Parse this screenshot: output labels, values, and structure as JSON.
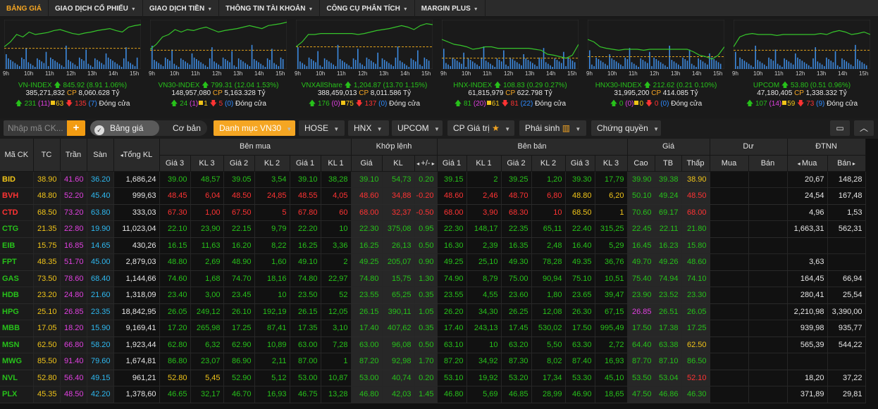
{
  "nav": {
    "items": [
      {
        "label": "BẢNG GIÁ",
        "active": true,
        "has_caret": false
      },
      {
        "label": "GIAO DỊCH CỔ PHIẾU",
        "has_caret": true
      },
      {
        "label": "GIAO DỊCH TIỀN",
        "has_caret": true
      },
      {
        "label": "THÔNG TIN TÀI KHOẢN",
        "has_caret": true
      },
      {
        "label": "CÔNG CỤ PHÂN TÍCH",
        "has_caret": true
      },
      {
        "label": "MARGIN PLUS",
        "has_caret": true
      }
    ]
  },
  "colors": {
    "up": "#27c11a",
    "down": "#ff3333",
    "ref": "#f0c419",
    "ceiling": "#e040e0",
    "floor": "#2eb8f0",
    "accent": "#f5a623",
    "chart_line": "#36c52b",
    "chart_bar": "#3d8ae0",
    "ref_line": "#e0a01a"
  },
  "indices": [
    {
      "name": "VN-INDEX",
      "value": "845.92",
      "change": "(8.91 1.06%)",
      "volume": "385,271,832",
      "cp": "CP",
      "value_text": "8,060.628 Tỷ",
      "up": "231",
      "up_ceil": "(11)",
      "ref": "63",
      "down": "135",
      "down_floor": "(7)",
      "status": "Đóng cửa",
      "dir": "up",
      "shape": [
        0.55,
        0.45,
        0.3,
        0.35,
        0.25,
        0.3,
        0.28,
        0.26,
        0.22,
        0.2,
        0.24,
        0.28,
        0.3,
        0.27,
        0.25,
        0.22,
        0.2,
        0.18,
        0.22,
        0.25,
        0.15,
        0.12,
        0.1
      ],
      "ref_level": 0.58
    },
    {
      "name": "VN30-INDEX",
      "value": "799.31",
      "change": "(12.04 1.53%)",
      "volume": "148,957,080",
      "cp": "CP",
      "value_text": "5,163.328 Tỷ",
      "up": "24",
      "up_ceil": "(1)",
      "ref": "1",
      "down": "5",
      "down_floor": "(0)",
      "status": "Đóng cửa",
      "dir": "up",
      "shape": [
        0.6,
        0.5,
        0.35,
        0.3,
        0.2,
        0.25,
        0.2,
        0.22,
        0.18,
        0.15,
        0.2,
        0.25,
        0.22,
        0.2,
        0.18,
        0.15,
        0.12,
        0.15,
        0.18,
        0.12,
        0.1,
        0.08,
        0.05
      ],
      "ref_level": 0.62
    },
    {
      "name": "VNXAllShare",
      "value": "1,204.87",
      "change": "(13.70 1.15%)",
      "volume": "388,459,013",
      "cp": "CP",
      "value_text": "8,011.586 Tỷ",
      "up": "176",
      "up_ceil": "(0)",
      "ref": "75",
      "down": "137",
      "down_floor": "(0)",
      "status": "Đóng cửa",
      "dir": "up",
      "shape": [
        0.55,
        0.45,
        0.3,
        0.3,
        0.28,
        0.28,
        0.28,
        0.28,
        0.28,
        0.28,
        0.3,
        0.28,
        0.25,
        0.22,
        0.2,
        0.18,
        0.15,
        0.12,
        0.15,
        0.2,
        0.12,
        0.08,
        0.1
      ],
      "ref_level": 0.55
    },
    {
      "name": "HNX-INDEX",
      "value": "108.83",
      "change": "(0.29 0.27%)",
      "volume": "61,815,979",
      "cp": "CP",
      "value_text": "622.798 Tỷ",
      "up": "81",
      "up_ceil": "(20)",
      "ref": "61",
      "down": "81",
      "down_floor": "(22)",
      "status": "Đóng cửa",
      "dir": "up",
      "shape": [
        0.4,
        0.45,
        0.5,
        0.52,
        0.55,
        0.6,
        0.58,
        0.55,
        0.55,
        0.58,
        0.58,
        0.58,
        0.58,
        0.58,
        0.58,
        0.6,
        0.62,
        0.7,
        0.72,
        0.75,
        0.78,
        0.72,
        0.5
      ],
      "ref_level": 0.78
    },
    {
      "name": "HNX30-INDEX",
      "value": "212.62",
      "change": "(0.21 0.10%)",
      "volume": "31,995,200",
      "cp": "CP",
      "value_text": "414.085 Tỷ",
      "up": "0",
      "up_ceil": "(0)",
      "ref": "0",
      "down": "0",
      "down_floor": "(0)",
      "status": "Đóng cửa",
      "dir": "up",
      "shape": [
        0.4,
        0.45,
        0.55,
        0.58,
        0.6,
        0.62,
        0.6,
        0.6,
        0.6,
        0.62,
        0.6,
        0.6,
        0.6,
        0.6,
        0.6,
        0.6,
        0.6,
        0.65,
        0.72,
        0.75,
        0.8,
        0.72,
        0.55
      ],
      "ref_level": 0.75
    },
    {
      "name": "UPCOM",
      "value": "53.80",
      "change": "(0.51 0.96%)",
      "volume": "47,180,405",
      "cp": "CP",
      "value_text": "1,338.332 Tỷ",
      "up": "107",
      "up_ceil": "(14)",
      "ref": "59",
      "down": "73",
      "down_floor": "(9)",
      "status": "Đóng cửa",
      "dir": "up",
      "shape": [
        0.55,
        0.35,
        0.3,
        0.28,
        0.3,
        0.3,
        0.3,
        0.32,
        0.3,
        0.3,
        0.3,
        0.3,
        0.3,
        0.3,
        0.28,
        0.3,
        0.25,
        0.22,
        0.25,
        0.3,
        0.28,
        0.25,
        0.3
      ],
      "ref_level": 0.62
    }
  ],
  "time_ticks": [
    "9h",
    "10h",
    "11h",
    "12h",
    "13h",
    "14h",
    "15h"
  ],
  "toolbar": {
    "search_placeholder": "Nhập mã CK...",
    "add_label": "+",
    "toggle_on": "Bảng giá",
    "toggle_off": "Cơ bản",
    "tabs": [
      {
        "label": "Danh mục VN30",
        "active": true
      },
      {
        "label": "HOSE"
      },
      {
        "label": "HNX"
      },
      {
        "label": "UPCOM"
      },
      {
        "label": "CP Giá trị",
        "star": "★"
      },
      {
        "label": "Phái sinh",
        "chart_icon": true
      },
      {
        "label": "Chứng quyền"
      }
    ]
  },
  "table": {
    "headers": {
      "symbol": "Mã CK",
      "ref": "TC",
      "ceiling": "Trần",
      "floor": "Sàn",
      "total_vol": "Tổng KL",
      "bid": "Bên mua",
      "match": "Khớp lệnh",
      "ask": "Bên bán",
      "price": "Giá",
      "residual": "Dư",
      "foreign": "ĐTNN",
      "bid_cols": [
        "Giá 3",
        "KL 3",
        "Giá 2",
        "KL 2",
        "Giá 1",
        "KL 1"
      ],
      "match_cols": [
        "Giá",
        "KL",
        "+/-"
      ],
      "ask_cols": [
        "Giá 1",
        "KL 1",
        "Giá 2",
        "KL 2",
        "Giá 3",
        "KL 3"
      ],
      "price_cols": [
        "Cao",
        "TB",
        "Thấp"
      ],
      "residual_cols": [
        "Mua",
        "Bán"
      ],
      "foreign_cols": [
        "Mua",
        "Bán"
      ]
    },
    "rows": [
      {
        "sym": "BID",
        "c": "f",
        "tc": "38.90",
        "tran": "41.60",
        "san": "36.20",
        "tkl": "1,686,24",
        "b3": "39.00",
        "bk3": "48,57",
        "b2": "39.05",
        "bk2": "3,54",
        "b1": "39.10",
        "bk1": "38,28",
        "mp": "39.10",
        "mk": "54,73",
        "chg": "0.20",
        "a1": "39.15",
        "ak1": "2",
        "a2": "39.25",
        "ak2": "1,20",
        "a3": "39.30",
        "ak3": "17,79",
        "hi": "39.90",
        "avg": "39.38",
        "lo": "38.90",
        "dm": "",
        "db": "",
        "fb": "20,67",
        "fs": "148,28",
        "cb3": "g",
        "cb2": "g",
        "cb1": "g",
        "cm": "g",
        "ca1": "g",
        "ca2": "g",
        "ca3": "g",
        "chi": "g",
        "cavg": "g",
        "clo": "y"
      },
      {
        "sym": "BVH",
        "c": "r",
        "tc": "48.80",
        "tran": "52.20",
        "san": "45.40",
        "tkl": "999,63",
        "b3": "48.45",
        "bk3": "6,04",
        "b2": "48.50",
        "bk2": "24,85",
        "b1": "48.55",
        "bk1": "4,05",
        "mp": "48.60",
        "mk": "34,88",
        "chg": "-0.20",
        "a1": "48.60",
        "ak1": "2,46",
        "a2": "48.70",
        "ak2": "6,80",
        "a3": "48.80",
        "ak3": "6,20",
        "hi": "50.10",
        "avg": "49.24",
        "lo": "48.50",
        "dm": "",
        "db": "",
        "fb": "24,54",
        "fs": "167,48",
        "cb3": "r",
        "cb2": "r",
        "cb1": "r",
        "cm": "r",
        "ca1": "r",
        "ca2": "r",
        "ca3": "y",
        "chi": "g",
        "cavg": "g",
        "clo": "r"
      },
      {
        "sym": "CTD",
        "c": "r",
        "tc": "68.50",
        "tran": "73.20",
        "san": "63.80",
        "tkl": "333,03",
        "b3": "67.30",
        "bk3": "1,00",
        "b2": "67.50",
        "bk2": "5",
        "b1": "67.80",
        "bk1": "60",
        "mp": "68.00",
        "mk": "32,37",
        "chg": "-0.50",
        "a1": "68.00",
        "ak1": "3,90",
        "a2": "68.30",
        "ak2": "10",
        "a3": "68.50",
        "ak3": "1",
        "hi": "70.60",
        "avg": "69.17",
        "lo": "68.00",
        "dm": "",
        "db": "",
        "fb": "4,96",
        "fs": "1,53",
        "cb3": "r",
        "cb2": "r",
        "cb1": "r",
        "cm": "r",
        "ca1": "r",
        "ca2": "r",
        "ca3": "y",
        "chi": "g",
        "cavg": "g",
        "clo": "r"
      },
      {
        "sym": "CTG",
        "c": "g",
        "tc": "21.35",
        "tran": "22.80",
        "san": "19.90",
        "tkl": "11,023,04",
        "b3": "22.10",
        "bk3": "23,90",
        "b2": "22.15",
        "bk2": "9,79",
        "b1": "22.20",
        "bk1": "10",
        "mp": "22.30",
        "mk": "375,08",
        "chg": "0.95",
        "a1": "22.30",
        "ak1": "148,17",
        "a2": "22.35",
        "ak2": "65,11",
        "a3": "22.40",
        "ak3": "315,25",
        "hi": "22.45",
        "avg": "22.11",
        "lo": "21.80",
        "dm": "",
        "db": "",
        "fb": "1,663,31",
        "fs": "562,31",
        "cb3": "g",
        "cb2": "g",
        "cb1": "g",
        "cm": "g",
        "ca1": "g",
        "ca2": "g",
        "ca3": "g",
        "chi": "g",
        "cavg": "g",
        "clo": "g"
      },
      {
        "sym": "EIB",
        "c": "g",
        "tc": "15.75",
        "tran": "16.85",
        "san": "14.65",
        "tkl": "430,26",
        "b3": "16.15",
        "bk3": "11,63",
        "b2": "16.20",
        "bk2": "8,22",
        "b1": "16.25",
        "bk1": "3,36",
        "mp": "16.25",
        "mk": "26,13",
        "chg": "0.50",
        "a1": "16.30",
        "ak1": "2,39",
        "a2": "16.35",
        "ak2": "2,48",
        "a3": "16.40",
        "ak3": "5,29",
        "hi": "16.45",
        "avg": "16.23",
        "lo": "15.80",
        "dm": "",
        "db": "",
        "fb": "",
        "fs": "",
        "cb3": "g",
        "cb2": "g",
        "cb1": "g",
        "cm": "g",
        "ca1": "g",
        "ca2": "g",
        "ca3": "g",
        "chi": "g",
        "cavg": "g",
        "clo": "g"
      },
      {
        "sym": "FPT",
        "c": "g",
        "tc": "48.35",
        "tran": "51.70",
        "san": "45.00",
        "tkl": "2,879,03",
        "b3": "48.80",
        "bk3": "2,69",
        "b2": "48.90",
        "bk2": "1,60",
        "b1": "49.10",
        "bk1": "2",
        "mp": "49.25",
        "mk": "205,07",
        "chg": "0.90",
        "a1": "49.25",
        "ak1": "25,10",
        "a2": "49.30",
        "ak2": "78,28",
        "a3": "49.35",
        "ak3": "36,76",
        "hi": "49.70",
        "avg": "49.26",
        "lo": "48.60",
        "dm": "",
        "db": "",
        "fb": "3,63",
        "fs": "",
        "cb3": "g",
        "cb2": "g",
        "cb1": "g",
        "cm": "g",
        "ca1": "g",
        "ca2": "g",
        "ca3": "g",
        "chi": "g",
        "cavg": "g",
        "clo": "g"
      },
      {
        "sym": "GAS",
        "c": "g",
        "tc": "73.50",
        "tran": "78.60",
        "san": "68.40",
        "tkl": "1,144,66",
        "b3": "74.60",
        "bk3": "1,68",
        "b2": "74.70",
        "bk2": "18,16",
        "b1": "74.80",
        "bk1": "22,97",
        "mp": "74.80",
        "mk": "15,75",
        "chg": "1.30",
        "a1": "74.90",
        "ak1": "8,79",
        "a2": "75.00",
        "ak2": "90,94",
        "a3": "75.10",
        "ak3": "10,51",
        "hi": "75.40",
        "avg": "74.94",
        "lo": "74.10",
        "dm": "",
        "db": "",
        "fb": "164,45",
        "fs": "66,94",
        "cb3": "g",
        "cb2": "g",
        "cb1": "g",
        "cm": "g",
        "ca1": "g",
        "ca2": "g",
        "ca3": "g",
        "chi": "g",
        "cavg": "g",
        "clo": "g"
      },
      {
        "sym": "HDB",
        "c": "g",
        "tc": "23.20",
        "tran": "24.80",
        "san": "21.60",
        "tkl": "1,318,09",
        "b3": "23.40",
        "bk3": "3,00",
        "b2": "23.45",
        "bk2": "10",
        "b1": "23.50",
        "bk1": "52",
        "mp": "23.55",
        "mk": "65,25",
        "chg": "0.35",
        "a1": "23.55",
        "ak1": "4,55",
        "a2": "23.60",
        "ak2": "1,80",
        "a3": "23.65",
        "ak3": "39,47",
        "hi": "23.90",
        "avg": "23.52",
        "lo": "23.30",
        "dm": "",
        "db": "",
        "fb": "280,41",
        "fs": "25,54",
        "cb3": "g",
        "cb2": "g",
        "cb1": "g",
        "cm": "g",
        "ca1": "g",
        "ca2": "g",
        "ca3": "g",
        "chi": "g",
        "cavg": "g",
        "clo": "g"
      },
      {
        "sym": "HPG",
        "c": "g",
        "tc": "25.10",
        "tran": "26.85",
        "san": "23.35",
        "tkl": "18,842,95",
        "b3": "26.05",
        "bk3": "249,12",
        "b2": "26.10",
        "bk2": "192,19",
        "b1": "26.15",
        "bk1": "12,05",
        "mp": "26.15",
        "mk": "390,11",
        "chg": "1.05",
        "a1": "26.20",
        "ak1": "34,30",
        "a2": "26.25",
        "ak2": "12,08",
        "a3": "26.30",
        "ak3": "67,15",
        "hi": "26.85",
        "avg": "26.51",
        "lo": "26.05",
        "dm": "",
        "db": "",
        "fb": "2,210,98",
        "fs": "3,390,00",
        "cb3": "g",
        "cb2": "g",
        "cb1": "g",
        "cm": "g",
        "ca1": "g",
        "ca2": "g",
        "ca3": "g",
        "chi": "p",
        "cavg": "g",
        "clo": "g"
      },
      {
        "sym": "MBB",
        "c": "g",
        "tc": "17.05",
        "tran": "18.20",
        "san": "15.90",
        "tkl": "9,169,41",
        "b3": "17.20",
        "bk3": "265,98",
        "b2": "17.25",
        "bk2": "87,41",
        "b1": "17.35",
        "bk1": "3,10",
        "mp": "17.40",
        "mk": "407,62",
        "chg": "0.35",
        "a1": "17.40",
        "ak1": "243,13",
        "a2": "17.45",
        "ak2": "530,02",
        "a3": "17.50",
        "ak3": "995,49",
        "hi": "17.50",
        "avg": "17.38",
        "lo": "17.25",
        "dm": "",
        "db": "",
        "fb": "939,98",
        "fs": "935,77",
        "cb3": "g",
        "cb2": "g",
        "cb1": "g",
        "cm": "g",
        "ca1": "g",
        "ca2": "g",
        "ca3": "g",
        "chi": "g",
        "cavg": "g",
        "clo": "g"
      },
      {
        "sym": "MSN",
        "c": "g",
        "tc": "62.50",
        "tran": "66.80",
        "san": "58.20",
        "tkl": "1,923,44",
        "b3": "62.80",
        "bk3": "6,32",
        "b2": "62.90",
        "bk2": "10,89",
        "b1": "63.00",
        "bk1": "7,28",
        "mp": "63.00",
        "mk": "96,08",
        "chg": "0.50",
        "a1": "63.10",
        "ak1": "10",
        "a2": "63.20",
        "ak2": "5,50",
        "a3": "63.30",
        "ak3": "2,72",
        "hi": "64.40",
        "avg": "63.38",
        "lo": "62.50",
        "dm": "",
        "db": "",
        "fb": "565,39",
        "fs": "544,22",
        "cb3": "g",
        "cb2": "g",
        "cb1": "g",
        "cm": "g",
        "ca1": "g",
        "ca2": "g",
        "ca3": "g",
        "chi": "g",
        "cavg": "g",
        "clo": "y"
      },
      {
        "sym": "MWG",
        "c": "g",
        "tc": "85.50",
        "tran": "91.40",
        "san": "79.60",
        "tkl": "1,674,81",
        "b3": "86.80",
        "bk3": "23,07",
        "b2": "86.90",
        "bk2": "2,11",
        "b1": "87.00",
        "bk1": "1",
        "mp": "87.20",
        "mk": "92,98",
        "chg": "1.70",
        "a1": "87.20",
        "ak1": "34,92",
        "a2": "87.30",
        "ak2": "8,02",
        "a3": "87.40",
        "ak3": "16,93",
        "hi": "87.70",
        "avg": "87.10",
        "lo": "86.50",
        "dm": "",
        "db": "",
        "fb": "",
        "fs": "",
        "cb3": "g",
        "cb2": "g",
        "cb1": "g",
        "cm": "g",
        "ca1": "g",
        "ca2": "g",
        "ca3": "g",
        "chi": "g",
        "cavg": "g",
        "clo": "g"
      },
      {
        "sym": "NVL",
        "c": "g",
        "tc": "52.80",
        "tran": "56.40",
        "san": "49.15",
        "tkl": "961,21",
        "b3": "52.80",
        "bk3": "5,45",
        "b2": "52.90",
        "bk2": "5,12",
        "b1": "53.00",
        "bk1": "10,87",
        "mp": "53.00",
        "mk": "40,74",
        "chg": "0.20",
        "a1": "53.10",
        "ak1": "19,92",
        "a2": "53.20",
        "ak2": "17,34",
        "a3": "53.30",
        "ak3": "45,10",
        "hi": "53.50",
        "avg": "53.04",
        "lo": "52.10",
        "dm": "",
        "db": "",
        "fb": "18,20",
        "fs": "37,22",
        "cb3": "y",
        "cb2": "g",
        "cb1": "g",
        "cm": "g",
        "ca1": "g",
        "ca2": "g",
        "ca3": "g",
        "chi": "g",
        "cavg": "g",
        "clo": "r"
      },
      {
        "sym": "PLX",
        "c": "g",
        "tc": "45.35",
        "tran": "48.50",
        "san": "42.20",
        "tkl": "1,378,60",
        "b3": "46.65",
        "bk3": "32,17",
        "b2": "46.70",
        "bk2": "16,93",
        "b1": "46.75",
        "bk1": "13,28",
        "mp": "46.80",
        "mk": "42,03",
        "chg": "1.45",
        "a1": "46.80",
        "ak1": "5,69",
        "a2": "46.85",
        "ak2": "28,99",
        "a3": "46.90",
        "ak3": "18,65",
        "hi": "47.50",
        "avg": "46.86",
        "lo": "46.30",
        "dm": "",
        "db": "",
        "fb": "371,89",
        "fs": "29,81",
        "cb3": "g",
        "cb2": "g",
        "cb1": "g",
        "cm": "g",
        "ca1": "g",
        "ca2": "g",
        "ca3": "g",
        "chi": "g",
        "cavg": "g",
        "clo": "g"
      }
    ]
  },
  "icons": {
    "screen": "monitor-icon",
    "collapse": "chevron-up-icon"
  }
}
